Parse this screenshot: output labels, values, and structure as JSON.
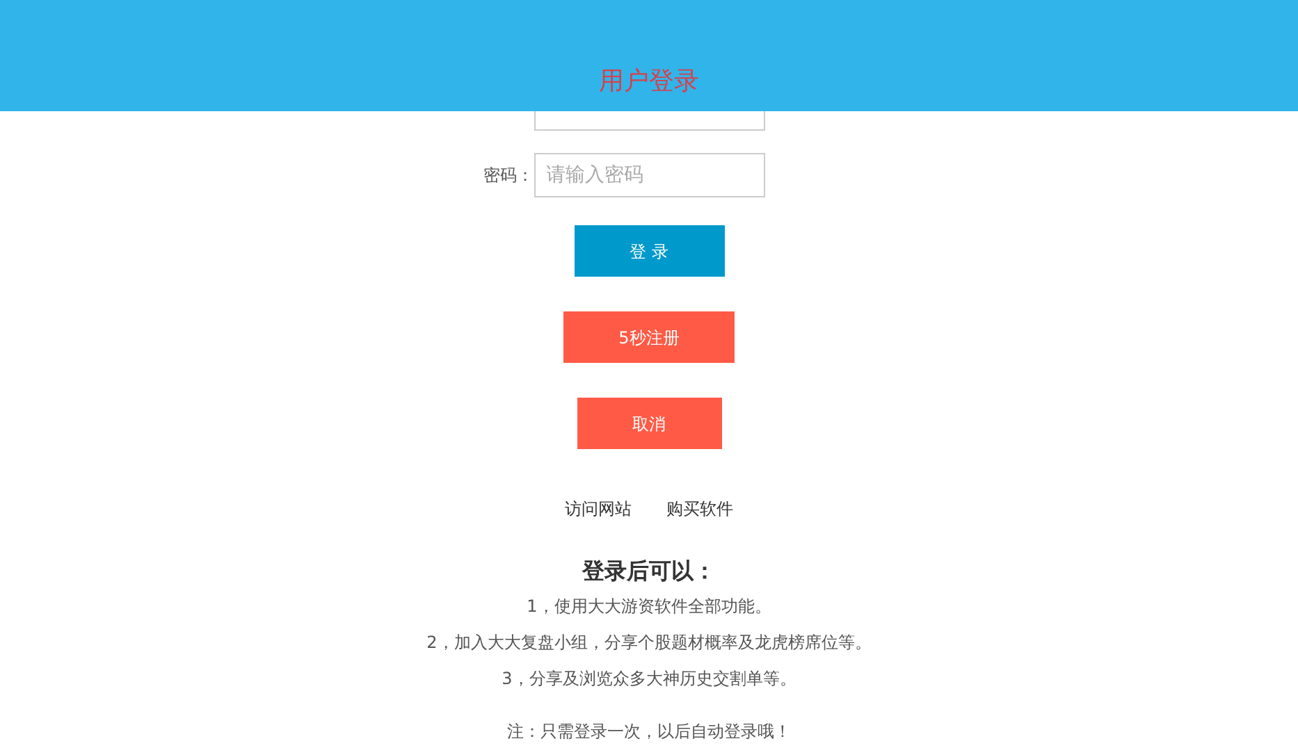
{
  "header": {
    "title": "用户登录"
  },
  "fields": [
    {
      "label": "密码：",
      "placeholder": "请输入密码"
    }
  ],
  "buttons": [
    {
      "label": "登 录",
      "kind": "primary"
    },
    {
      "label": "5秒注册",
      "kind": "danger"
    },
    {
      "label": "取消",
      "kind": "danger"
    }
  ],
  "links": [
    "访问网站",
    "购买软件"
  ],
  "benefits": {
    "title": "登录后可以：",
    "items": [
      "1，使用大大游资软件全部功能。",
      "2，加入大大复盘小组，分享个股题材概率及龙虎榜席位等。",
      "3，分享及浏览众多大神历史交割单等。"
    ],
    "note": "注：只需登录一次，以后自动登录哦！"
  }
}
